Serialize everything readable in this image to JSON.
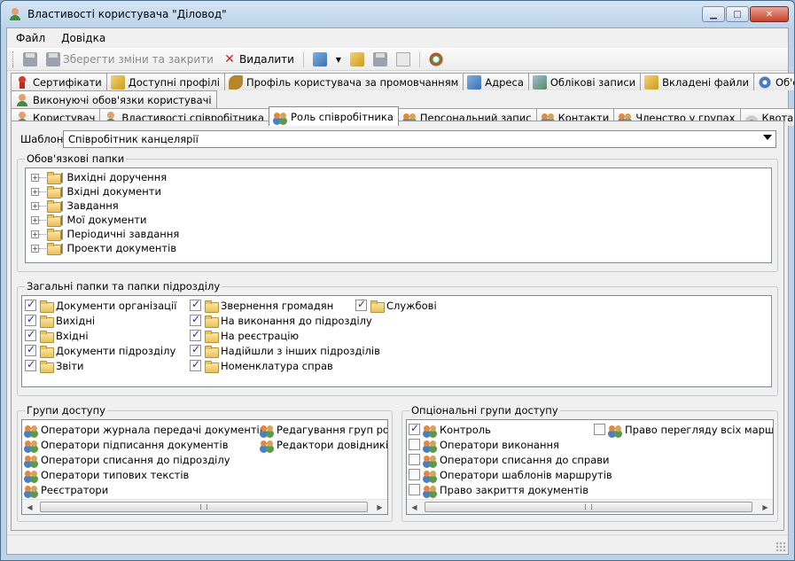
{
  "window": {
    "title": "Властивості користувача \"Діловод\"",
    "controls": {
      "minimize": "▁",
      "maximize": "□",
      "close": "✕"
    }
  },
  "menu": {
    "items": [
      "Файл",
      "Довідка"
    ]
  },
  "toolbar": {
    "save_close": "Зберегти зміни та закрити",
    "delete": "Видалити",
    "dropdown_glyph": "▾"
  },
  "tabs_row1": [
    {
      "label": "Сертифікати",
      "icon": "red-user-icon"
    },
    {
      "label": "Доступні профілі",
      "icon": "profiles-icon"
    },
    {
      "label": "Профіль користувача за промовчанням",
      "icon": "book-icon"
    },
    {
      "label": "Адреса",
      "icon": "address-icon"
    },
    {
      "label": "Облікові записи",
      "icon": "accounts-icon"
    },
    {
      "label": "Вкладені файли",
      "icon": "attachment-icon"
    },
    {
      "label": "Об'єкт",
      "icon": "gear-icon"
    }
  ],
  "tabs_row2": [
    {
      "label": "Виконуючі обов'язки користувачі",
      "icon": "acting-users-icon"
    }
  ],
  "tabs_row3": [
    {
      "label": "Користувач",
      "icon": "user-icon",
      "active": false
    },
    {
      "label": "Властивості співробітника",
      "icon": "employee-props-icon",
      "active": false
    },
    {
      "label": "Роль співробітника",
      "icon": "role-icon",
      "active": true
    },
    {
      "label": "Персональний запис",
      "icon": "personal-record-icon",
      "active": false
    },
    {
      "label": "Контакти",
      "icon": "contacts-icon",
      "active": false
    },
    {
      "label": "Членство у групах",
      "icon": "groups-icon",
      "active": false
    },
    {
      "label": "Квота",
      "icon": "quota-icon",
      "active": false
    }
  ],
  "shablon": {
    "label": "Шаблон:",
    "value": "Співробітник канцелярії"
  },
  "mandatory_folders": {
    "title": "Обов'язкові папки",
    "items": [
      "| Вихідні доручення",
      "| Вхідні документи",
      "| Завдання",
      "| Мої документи",
      "| Періодичні завдання",
      "| Проекти документів"
    ],
    "expander": "+"
  },
  "general_folders": {
    "title": "Загальні папки та папки підрозділу",
    "col1": [
      {
        "label": "Документи організації",
        "checked": true
      },
      {
        "label": "Вихідні",
        "checked": true
      },
      {
        "label": "Вхідні",
        "checked": true
      },
      {
        "label": "Документи підрозділу",
        "checked": true
      },
      {
        "label": "Звіти",
        "checked": true
      }
    ],
    "col2": [
      {
        "label": "Звернення громадян",
        "checked": true
      },
      {
        "label": "На виконання до підрозділу",
        "checked": true
      },
      {
        "label": "На реєстрацію",
        "checked": true
      },
      {
        "label": "Надійшли з інших підрозділів",
        "checked": true
      },
      {
        "label": "Номенклатура справ",
        "checked": true
      }
    ],
    "col3": [
      {
        "label": "Службові",
        "checked": true
      }
    ]
  },
  "access_groups": {
    "title": "Групи доступу",
    "col1": [
      "Оператори журнала передачі документів",
      "Оператори підписання документів",
      "Оператори списання до підрозділу",
      "Оператори типових текстів",
      "Реєстратори"
    ],
    "col2": [
      "Редагування груп розси",
      "Редактори довідників під"
    ]
  },
  "optional_groups": {
    "title": "Опціональні групи доступу",
    "col1": [
      {
        "label": "Контроль",
        "checked": true
      },
      {
        "label": "Оператори виконання",
        "checked": false
      },
      {
        "label": "Оператори списання до справи",
        "checked": false
      },
      {
        "label": "Оператори шаблонів маршрутів",
        "checked": false
      },
      {
        "label": "Право закриття документів",
        "checked": false
      }
    ],
    "col2": [
      {
        "label": "Право перегляду всіх маршрутів",
        "checked": false
      }
    ]
  },
  "scroll": {
    "left": "◀",
    "right": "▶"
  }
}
